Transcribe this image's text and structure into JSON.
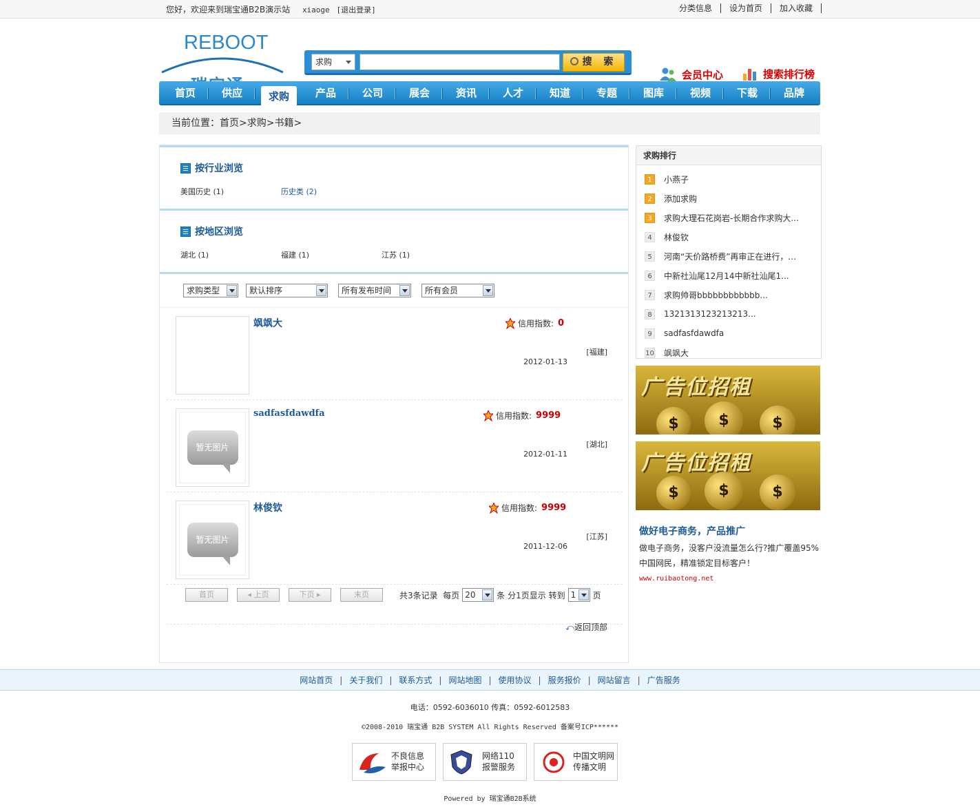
{
  "topbar": {
    "welcome": "您好，欢迎来到瑞宝通B2B演示站",
    "username": "xiaoge",
    "logout": "[退出登录]",
    "links": [
      "分类信息",
      "设为首页",
      "加入收藏"
    ]
  },
  "logo": {
    "en": "REBOOT",
    "cn": "瑞宝通"
  },
  "search": {
    "type": "求购",
    "button": "搜 索",
    "value": ""
  },
  "header_links": {
    "member": "会员中心",
    "ranking": "搜索排行榜"
  },
  "nav": [
    "首页",
    "供应",
    "求购",
    "产品",
    "公司",
    "展会",
    "资讯",
    "人才",
    "知道",
    "专题",
    "图库",
    "视频",
    "下载",
    "品牌"
  ],
  "nav_active": "求购",
  "breadcrumb": "当前位置：首页>求购>书籍>",
  "industry": {
    "title": "按行业浏览",
    "items": [
      "美国历史 (1)",
      "历史类 (2)"
    ]
  },
  "region": {
    "title": "按地区浏览",
    "items": [
      "湖北 (1)",
      "福建 (1)",
      "江苏 (1)"
    ]
  },
  "filters": [
    "求购类型",
    "默认排序",
    "所有发布时间",
    "所有会员"
  ],
  "listings": [
    {
      "name": "飒飒大",
      "credit_label": "信用指数:",
      "credit": "0",
      "region": "[福建]",
      "date": "2012-01-13",
      "has_image": true
    },
    {
      "name": "sadfasfdawdfa",
      "credit_label": "信用指数:",
      "credit": "9999",
      "region": "[湖北]",
      "date": "2012-01-11",
      "has_image": false
    },
    {
      "name": "林俊钦",
      "credit_label": "信用指数:",
      "credit": "9999",
      "region": "[江苏]",
      "date": "2011-12-06",
      "has_image": false
    }
  ],
  "no_image": "暂无图片",
  "pager": {
    "first": "首页",
    "prev": "上页",
    "next": "下页",
    "last": "末页",
    "total": "共3条记录",
    "per_page_label": "每页",
    "per_page": "20",
    "unit": "条",
    "pages": "分1页显示",
    "goto": "转到",
    "page": "1",
    "page_unit": "页"
  },
  "back_top": "返回顶部",
  "rank": {
    "title": "求购排行",
    "items": [
      "小燕子",
      "添加求购",
      "求购大理石花岗岩-长期合作求购大...",
      "林俊钦",
      "河南“天价路桥费”再审正在进行，...",
      "中新社汕尾12月14中新社汕尾1...",
      "求购帅哥bbbbbbbbbbbb...",
      "1321313123213213...",
      "sadfasfdawdfa",
      "飒飒大"
    ]
  },
  "ad_text": "广告位招租",
  "promo": {
    "title": "做好电子商务，产品推广",
    "body": "做电子商务，没客户没流量怎么行?推广覆盖95%中国网民，精准锁定目标客户！",
    "url": "www.ruibaotong.net"
  },
  "footer_links": [
    "网站首页",
    "关于我们",
    "联系方式",
    "网站地图",
    "使用协议",
    "服务报价",
    "网站留言",
    "广告服务"
  ],
  "contact": "电话：0592-6036010 传真：0592-6012583",
  "copyright": "©2008-2010 瑞宝通 B2B SYSTEM All Rights Reserved 备案号ICP******",
  "badges": [
    {
      "l1": "不良信息",
      "l2": "举报中心"
    },
    {
      "l1": "网络110",
      "l2": "报警服务"
    },
    {
      "l1": "中国文明网",
      "l2": "传播文明"
    }
  ],
  "powered": "Powered by 瑞宝通B2B系统"
}
